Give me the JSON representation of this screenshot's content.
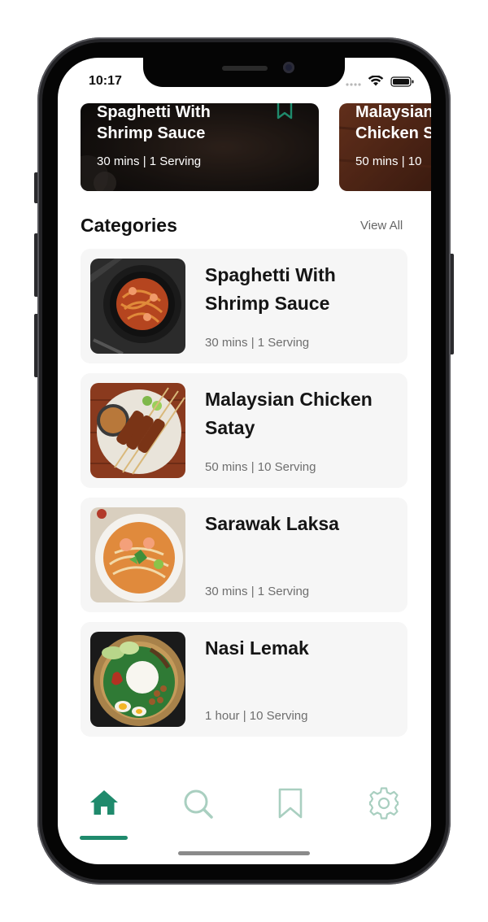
{
  "status_bar": {
    "time": "10:17"
  },
  "featured": [
    {
      "title": "Spaghetti With\nShrimp Sauce",
      "meta": "30 mins | 1 Serving"
    },
    {
      "title": "Malaysian\nChicken S",
      "meta": "50 mins | 10"
    }
  ],
  "categories": {
    "heading": "Categories",
    "view_all": "View All",
    "items": [
      {
        "title": "Spaghetti With Shrimp Sauce",
        "meta": "30 mins | 1 Serving"
      },
      {
        "title": "Malaysian Chicken Satay",
        "meta": "50 mins | 10 Serving"
      },
      {
        "title": "Sarawak Laksa",
        "meta": "30 mins | 1 Serving"
      },
      {
        "title": "Nasi Lemak",
        "meta": "1 hour | 10 Serving"
      }
    ]
  },
  "tabs": [
    {
      "icon": "home-icon",
      "active": true
    },
    {
      "icon": "search-icon",
      "active": false
    },
    {
      "icon": "bookmark-icon",
      "active": false
    },
    {
      "icon": "gear-icon",
      "active": false
    }
  ],
  "colors": {
    "accent": "#1f8a6c",
    "inactive_icon": "#a9cfc0",
    "card_bg": "#f6f6f6"
  }
}
